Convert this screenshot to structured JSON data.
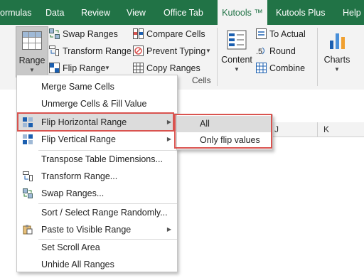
{
  "tabs": [
    {
      "label": "ormulas"
    },
    {
      "label": "Data"
    },
    {
      "label": "Review"
    },
    {
      "label": "View"
    },
    {
      "label": "Office Tab"
    },
    {
      "label": "Kutools ™"
    },
    {
      "label": "Kutools Plus"
    },
    {
      "label": "Help"
    }
  ],
  "ribbon": {
    "range_label": "Range",
    "swap_ranges": "Swap Ranges",
    "transform_range": "Transform Range",
    "flip_range": "Flip Range",
    "compare_cells": "Compare Cells",
    "prevent_typing": "Prevent Typing",
    "copy_ranges": "Copy Ranges",
    "content_label": "Content",
    "to_actual": "To Actual",
    "round": "Round",
    "combine": "Combine",
    "charts_label": "Charts",
    "cells_group_label": "Cells"
  },
  "columns": {
    "j": "J",
    "k": "K"
  },
  "menu": {
    "items": [
      {
        "label": "Merge Same Cells"
      },
      {
        "label": "Unmerge Cells & Fill Value"
      },
      {
        "label": "Flip Horizontal Range"
      },
      {
        "label": "Flip Vertical Range"
      },
      {
        "label": "Transpose Table Dimensions..."
      },
      {
        "label": "Transform Range..."
      },
      {
        "label": "Swap Ranges..."
      },
      {
        "label": "Sort / Select Range Randomly..."
      },
      {
        "label": "Paste to Visible Range"
      },
      {
        "label": "Set Scroll Area"
      },
      {
        "label": "Unhide All Ranges"
      }
    ]
  },
  "submenu": {
    "items": [
      {
        "label": "All"
      },
      {
        "label": "Only flip values"
      }
    ]
  },
  "colors": {
    "excel_green": "#217346",
    "highlight_border": "#d9534f"
  }
}
